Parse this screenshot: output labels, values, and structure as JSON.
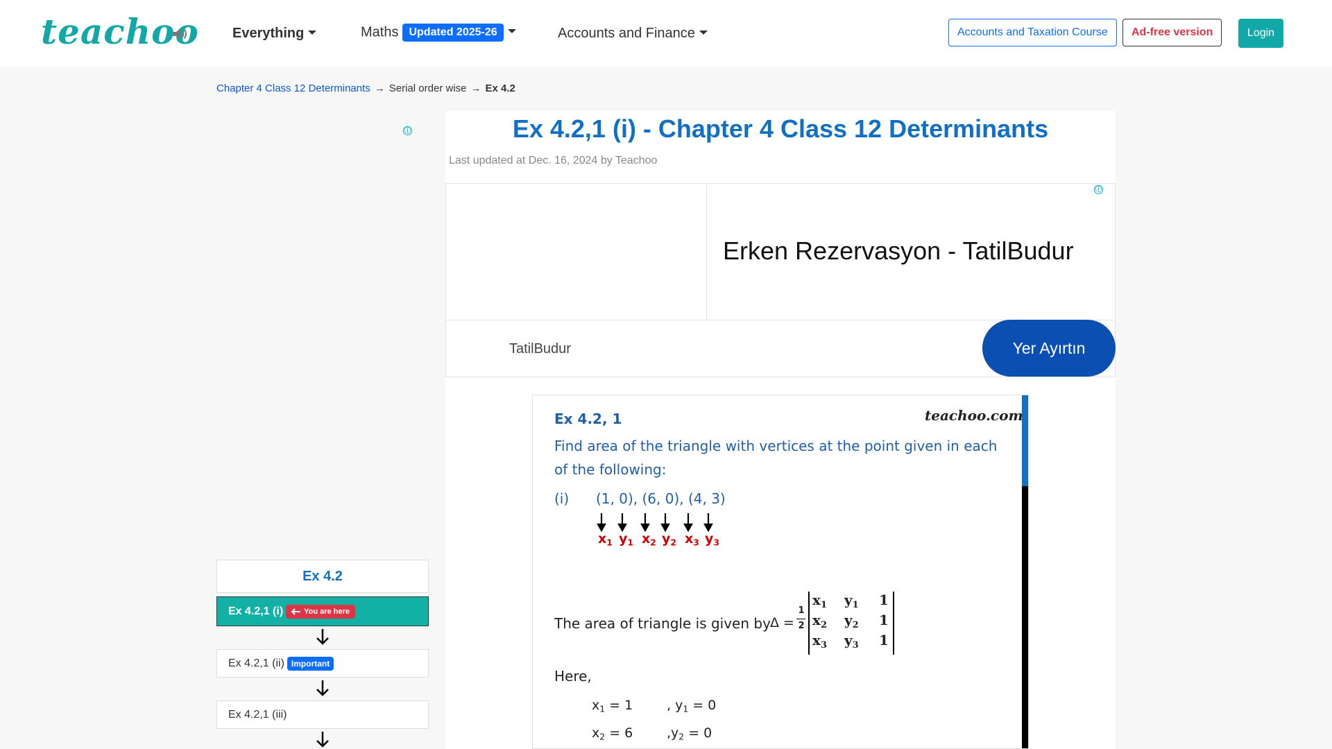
{
  "navbar": {
    "logo": "teachoo",
    "everything_label": "Everything",
    "maths_label": "Maths",
    "maths_badge": "Updated 2025-26",
    "accounts_label": "Accounts and Finance",
    "course_button": "Accounts and Taxation Course",
    "adfree_button": "Ad-free version",
    "login_button": "Login"
  },
  "breadcrumb": {
    "chapter": "Chapter 4 Class 12 Determinants",
    "section": "Serial order wise",
    "current": "Ex 4.2",
    "separator": "→"
  },
  "page": {
    "title": "Ex 4.2,1 (i) - Chapter 4 Class 12 Determinants",
    "meta": "Last updated at Dec. 16, 2024 by Teachoo"
  },
  "ad": {
    "info_glyph": "ⓘ",
    "headline": "Erken Rezervasyon - TatilBudur",
    "advertiser": "TatilBudur",
    "cta": "Yer Ayırtın"
  },
  "toc": {
    "title": "Ex 4.2",
    "items": [
      {
        "label": "Ex 4.2,1 (i)",
        "badge": "You are here"
      },
      {
        "label": "Ex 4.2,1 (ii)",
        "badge": "Important"
      },
      {
        "label": "Ex 4.2,1 (iii)",
        "badge": ""
      }
    ]
  },
  "solution": {
    "heading": "Ex 4.2, 1",
    "watermark": "teachoo.com",
    "question_line1": "Find area of the triangle with vertices at the point given in each",
    "question_line2": "of the following:",
    "part": "(i)",
    "points": "(1, 0), (6, 0), (4, 3)",
    "labels": [
      "x",
      "y",
      "x",
      "y",
      "x",
      "y"
    ],
    "label_subs": [
      "1",
      "1",
      "2",
      "2",
      "3",
      "3"
    ],
    "area_text": "The area of triangle is given by",
    "delta": "Δ =",
    "half_num": "1",
    "half_den": "2",
    "det_rows": [
      [
        "x",
        "1",
        "y",
        "1",
        "1"
      ],
      [
        "x",
        "2",
        "y",
        "2",
        "1"
      ],
      [
        "x",
        "3",
        "y",
        "3",
        "1"
      ]
    ],
    "here": "Here,",
    "values": [
      {
        "x": "x",
        "xs": "1",
        "xv": " = 1",
        "y": ", y",
        "ys": "1",
        "yv": " = 0"
      },
      {
        "x": "x",
        "xs": "2",
        "xv": " = 6",
        "y": ",y",
        "ys": "2",
        "yv": " = 0"
      }
    ]
  },
  "colors": {
    "brand": "#13a8a8",
    "link_blue": "#1170c5",
    "badge_blue": "#0d6efd",
    "badge_red": "#dc3545",
    "ad_cta": "#0b4fb3"
  }
}
